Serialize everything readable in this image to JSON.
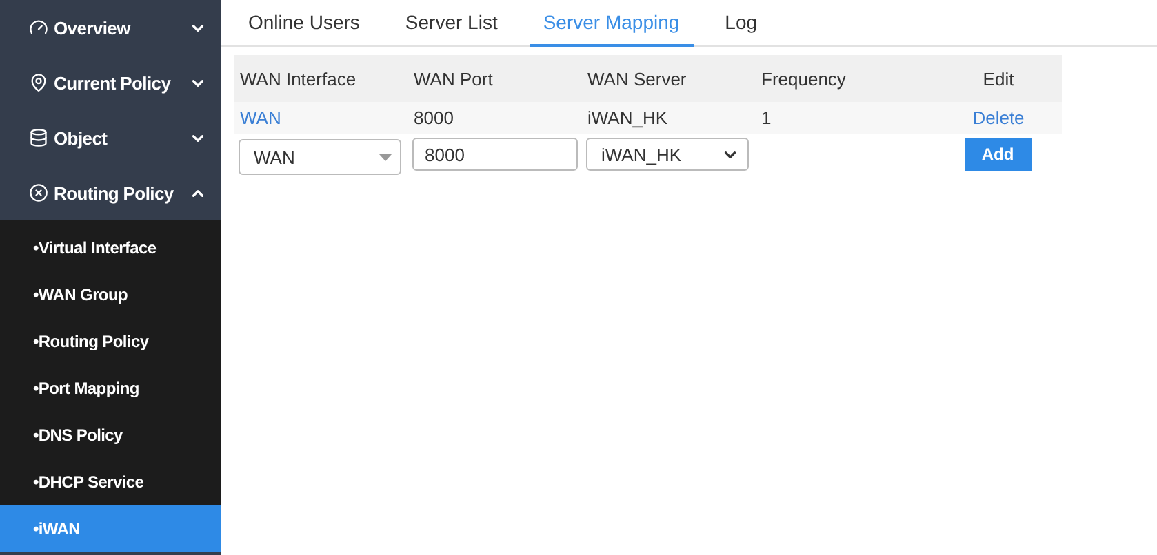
{
  "sidebar": {
    "items": [
      {
        "label": "Overview",
        "expanded": false
      },
      {
        "label": "Current Policy",
        "expanded": false
      },
      {
        "label": "Object",
        "expanded": false
      },
      {
        "label": "Routing Policy",
        "expanded": true,
        "children": [
          {
            "label": "•Virtual Interface",
            "selected": false
          },
          {
            "label": "•WAN Group",
            "selected": false
          },
          {
            "label": "•Routing Policy",
            "selected": false
          },
          {
            "label": "•Port Mapping",
            "selected": false
          },
          {
            "label": "•DNS Policy",
            "selected": false
          },
          {
            "label": "•DHCP Service",
            "selected": false
          },
          {
            "label": "•iWAN",
            "selected": true
          }
        ]
      }
    ]
  },
  "tabs": [
    {
      "label": "Online Users",
      "selected": false
    },
    {
      "label": "Server List",
      "selected": false
    },
    {
      "label": "Server Mapping",
      "selected": true
    },
    {
      "label": "Log",
      "selected": false
    }
  ],
  "table": {
    "columns": [
      "WAN Interface",
      "WAN Port",
      "WAN Server",
      "Frequency",
      "Edit"
    ],
    "rows": [
      {
        "interface": "WAN",
        "port": "8000",
        "server": "iWAN_HK",
        "frequency": "1",
        "action": "Delete"
      }
    ],
    "form": {
      "interface": "WAN",
      "port": "8000",
      "server": "iWAN_HK",
      "button": "Add"
    }
  }
}
